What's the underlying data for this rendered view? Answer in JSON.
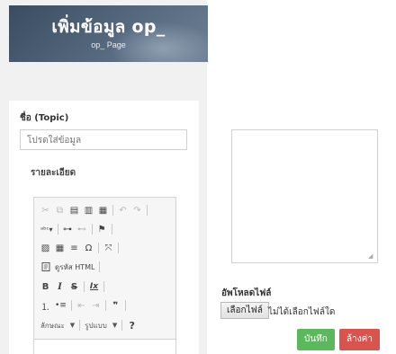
{
  "header": {
    "title": "เพิ่มข้อมูล op_",
    "subtitle": "op_ Page"
  },
  "form": {
    "topic_label": "ชื่อ (Topic)",
    "topic_placeholder": "โปรดใส่ข้อมูล",
    "detail_label": "รายละเอียด",
    "upload_label": "อัพโหลดไฟล์",
    "file_button_label": "เลือกไฟล์",
    "file_status": "ไม่ได้เลือกไฟล์ใด",
    "save_label": "บันทึก",
    "reset_label": "ล้างค่า"
  },
  "editor": {
    "row1": [
      {
        "name": "cut-icon",
        "glyph": "✂",
        "disabled": true
      },
      {
        "name": "copy-icon",
        "glyph": "⧉",
        "disabled": true
      },
      {
        "name": "paste-icon",
        "glyph": "▤",
        "disabled": false
      },
      {
        "name": "paste-text-icon",
        "glyph": "▥",
        "disabled": false
      },
      {
        "name": "paste-word-icon",
        "glyph": "▦",
        "disabled": false
      },
      {
        "name": "undo-icon",
        "glyph": "↶",
        "disabled": true
      },
      {
        "name": "redo-icon",
        "glyph": "↷",
        "disabled": true
      }
    ],
    "row2": [
      {
        "name": "spellcheck-icon",
        "glyph": "ᵃᵇᶜ▾",
        "disabled": false
      },
      {
        "name": "link-icon",
        "glyph": "⊶",
        "disabled": false
      },
      {
        "name": "unlink-icon",
        "glyph": "⊷",
        "disabled": true
      },
      {
        "name": "anchor-flag-icon",
        "glyph": "⚑",
        "disabled": false
      }
    ],
    "row3": [
      {
        "name": "image-icon",
        "glyph": "▨",
        "disabled": false
      },
      {
        "name": "table-icon",
        "glyph": "▦",
        "disabled": false
      },
      {
        "name": "horizontal-line-icon",
        "glyph": "≡",
        "disabled": false
      },
      {
        "name": "special-char-icon",
        "glyph": "Ω",
        "disabled": false
      },
      {
        "name": "maximize-icon",
        "glyph": "⤧",
        "disabled": false
      }
    ],
    "source_label": "ดูรหัส HTML",
    "row5": [
      {
        "name": "bold-icon",
        "glyph": "B",
        "disabled": false
      },
      {
        "name": "italic-icon",
        "glyph": "I",
        "disabled": false
      },
      {
        "name": "strike-icon",
        "glyph": "S",
        "disabled": false
      },
      {
        "name": "remove-format-icon",
        "glyph": "Ix",
        "disabled": false
      }
    ],
    "row6": [
      {
        "name": "numbered-list-icon",
        "glyph": "⒈",
        "disabled": false
      },
      {
        "name": "bulleted-list-icon",
        "glyph": "•≡",
        "disabled": false
      },
      {
        "name": "outdent-icon",
        "glyph": "⇤",
        "disabled": true
      },
      {
        "name": "indent-icon",
        "glyph": "⇥",
        "disabled": true
      },
      {
        "name": "blockquote-icon",
        "glyph": "❞",
        "disabled": false
      }
    ],
    "styles_combo": "ลักษณะ",
    "format_combo": "รูปแบบ",
    "help_icon": "?"
  }
}
